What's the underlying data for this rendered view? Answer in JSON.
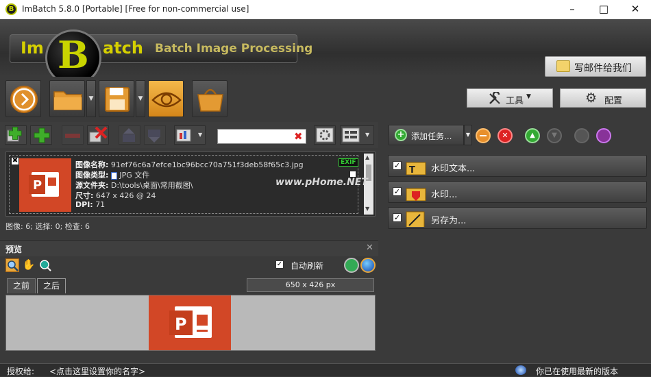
{
  "window": {
    "title": "ImBatch 5.8.0 [Portable] [Free for non-commercial use]",
    "logo_letter": "B"
  },
  "banner": {
    "word_left": "Im",
    "big_letter": "B",
    "word_right": "atch",
    "tagline": "Batch Image Processing",
    "mail_button": "写邮件给我们"
  },
  "toolbar": {
    "tools_label": "工具",
    "settings_label": "配置"
  },
  "images": {
    "items": [
      {
        "name_label": "图像名称:",
        "name_value": "91ef76c6a7efce1bc96bcc70a751f3deb58f65c3.jpg",
        "type_label": "图像类型:",
        "type_value": "JPG 文件",
        "folder_label": "源文件夹:",
        "folder_value": "D:\\tools\\桌面\\常用截图\\",
        "size_label": "尺寸:",
        "size_value": "647 x 426 @ 24",
        "dpi_label": "DPI:",
        "dpi_value": "71",
        "exif_badge": "EXIF"
      }
    ],
    "status": "图像: 6; 选择: 0; 检查: 6"
  },
  "preview": {
    "header": "预览",
    "auto_refresh": "自动刷新",
    "tab_before": "之前",
    "tab_after": "之后",
    "dimensions": "650 x 426 px"
  },
  "tasks": {
    "add_task": "添加任务...",
    "items": [
      {
        "label": "水印文本...",
        "checked": "✓"
      },
      {
        "label": "水印...",
        "checked": "✓"
      },
      {
        "label": "另存为...",
        "checked": "✓"
      }
    ]
  },
  "footer": {
    "licensed_to_label": "授权给:",
    "licensed_to_value": "<点击这里设置你的名字>",
    "version_status": "你已在使用最新的版本"
  },
  "overlays": {
    "watermark_url": "www.pHome.NET"
  },
  "colors": {
    "accent_yellow": "#c9d400",
    "panel_bg": "#3a3a3a",
    "ppt_red": "#d24726"
  }
}
